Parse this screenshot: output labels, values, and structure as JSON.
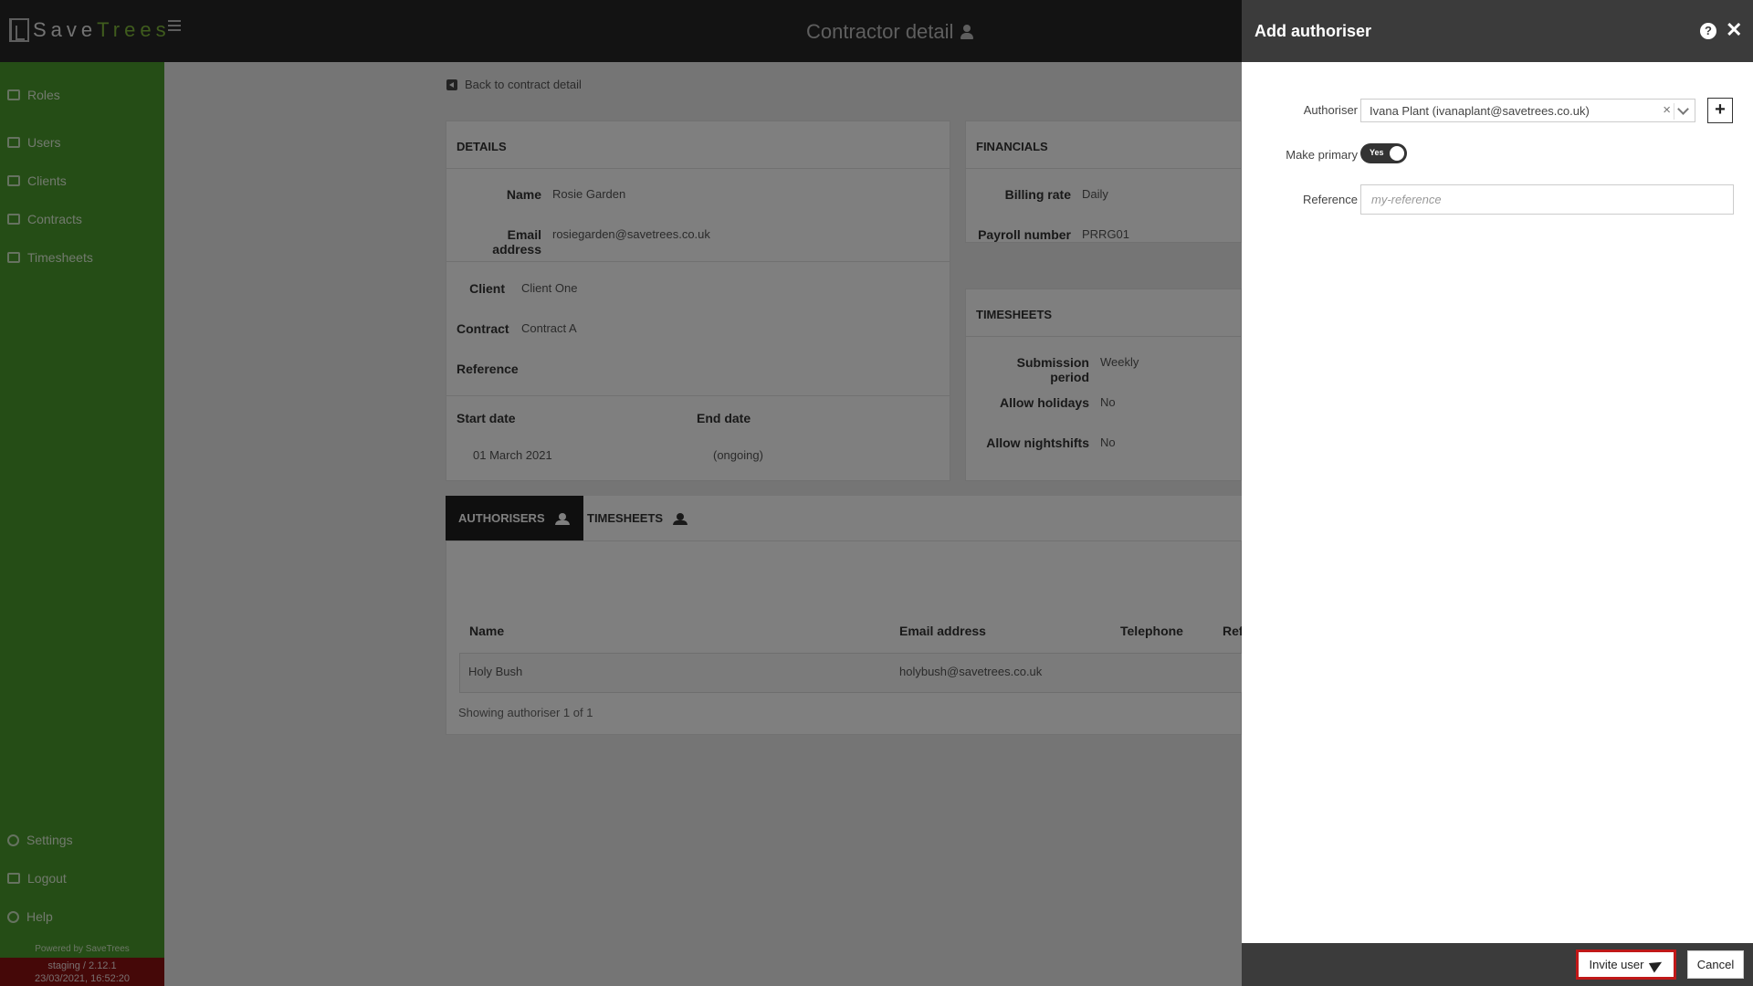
{
  "header": {
    "brand_save": "Save",
    "brand_trees": "Trees",
    "title": "Contractor detail"
  },
  "sidebar": {
    "items": [
      {
        "label": "Roles",
        "icon": "id-card-icon"
      },
      {
        "label": "Users",
        "icon": "address-book-icon"
      },
      {
        "label": "Clients",
        "icon": "building-icon"
      },
      {
        "label": "Contracts",
        "icon": "file-icon"
      },
      {
        "label": "Timesheets",
        "icon": "user-clock-icon"
      }
    ],
    "bottom_items": [
      {
        "label": "Settings",
        "icon": "gear-icon"
      },
      {
        "label": "Logout",
        "icon": "sign-out-icon"
      },
      {
        "label": "Help",
        "icon": "question-circle-icon"
      }
    ],
    "powered_by": "Powered by SaveTrees",
    "environment": "staging / 2.12.1",
    "build_time": "23/03/2021, 16:52:20"
  },
  "back_link": "Back to contract detail",
  "details": {
    "heading": "DETAILS",
    "name_label": "Name",
    "name_value": "Rosie Garden",
    "email_label": "Email address",
    "email_value": "rosiegarden@savetrees.co.uk",
    "client_label": "Client",
    "client_value": "Client One",
    "contract_label": "Contract",
    "contract_value": "Contract A",
    "reference_label": "Reference",
    "reference_value": "",
    "start_label": "Start date",
    "start_value": "01 March 2021",
    "end_label": "End date",
    "end_value": "(ongoing)"
  },
  "financials": {
    "heading": "FINANCIALS",
    "billing_label": "Billing rate",
    "billing_value": "Daily",
    "payroll_label": "Payroll number",
    "payroll_value": "PRRG01"
  },
  "timesheets_card": {
    "heading": "TIMESHEETS",
    "submission_label": "Submission period",
    "submission_value": "Weekly",
    "holidays_label": "Allow holidays",
    "holidays_value": "No",
    "nightshifts_label": "Allow nightshifts",
    "nightshifts_value": "No"
  },
  "tabs": [
    {
      "label": "AUTHORISERS",
      "active": true
    },
    {
      "label": "TIMESHEETS",
      "active": false
    }
  ],
  "table": {
    "columns": [
      "Name",
      "Email address",
      "Telephone",
      "Ref"
    ],
    "rows": [
      {
        "name": "Holy Bush",
        "email": "holybush@savetrees.co.uk",
        "telephone": "",
        "reference": ""
      }
    ],
    "footer": "Showing authoriser 1 of 1"
  },
  "drawer": {
    "title": "Add authoriser",
    "authoriser_label": "Authoriser",
    "authoriser_value": "Ivana Plant (ivanaplant@savetrees.co.uk)",
    "primary_label": "Make primary",
    "primary_toggle": "Yes",
    "reference_label": "Reference",
    "reference_placeholder": "my-reference",
    "invite_label": "Invite user",
    "cancel_label": "Cancel"
  },
  "colors": {
    "sidebar": "#4b9b2d",
    "topbar": "#262626",
    "version_banner": "#8b1010",
    "invite_highlight": "#c01818"
  }
}
